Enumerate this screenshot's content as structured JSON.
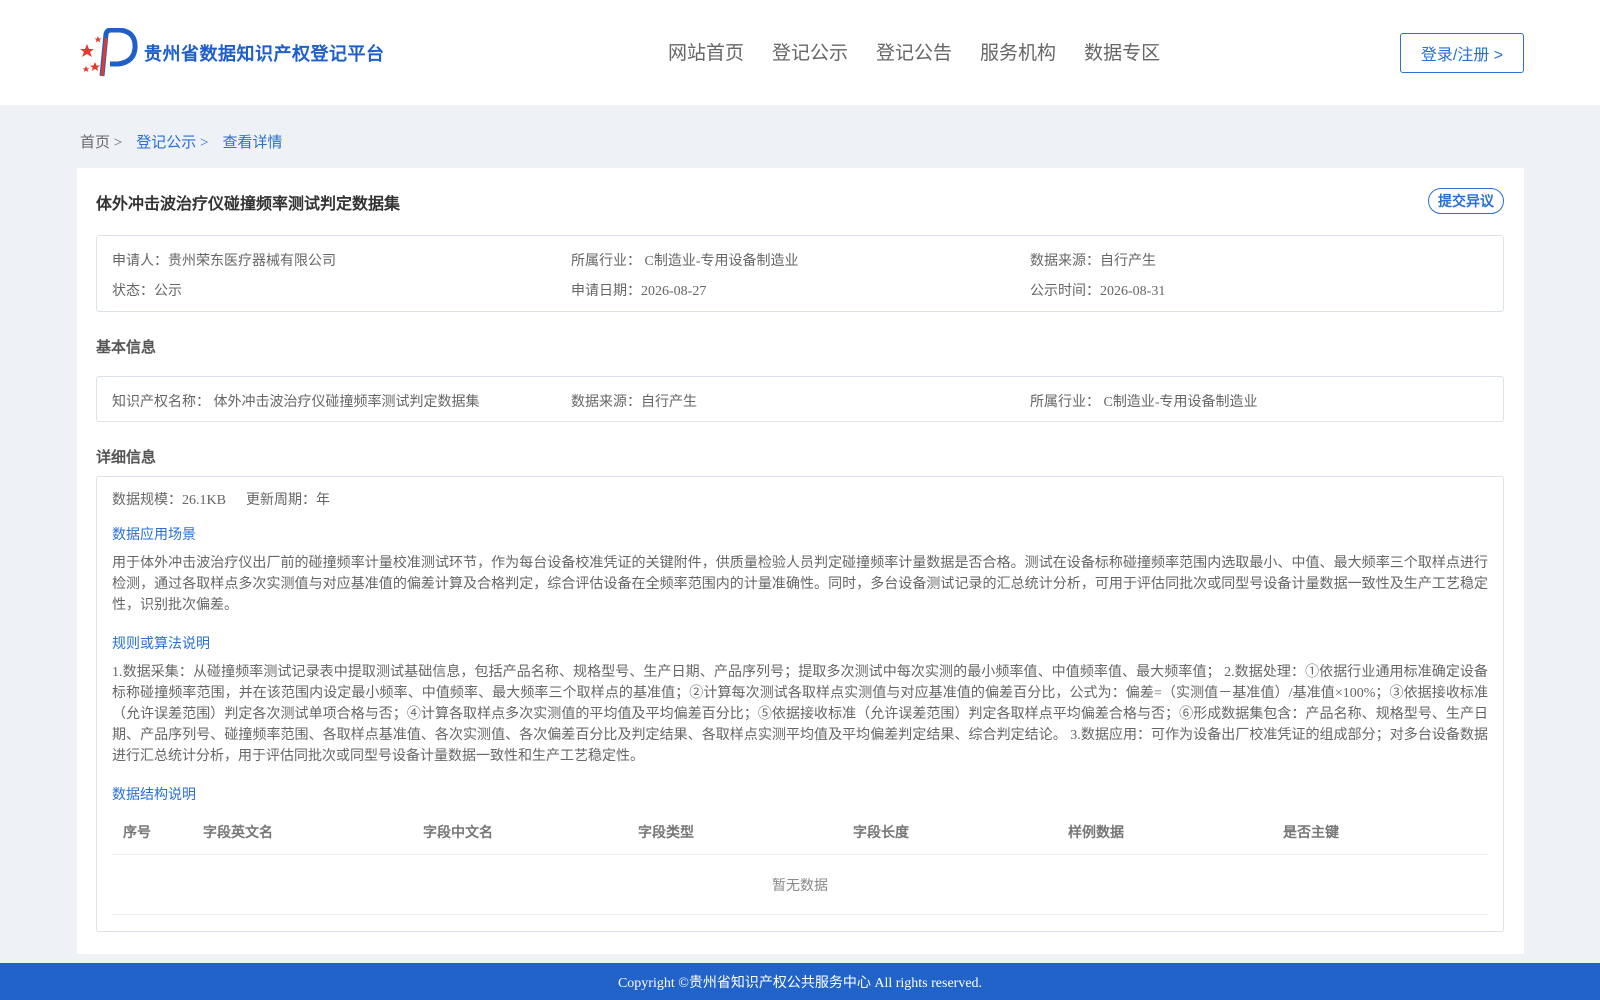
{
  "header": {
    "site_title": "贵州省数据知识产权登记平台",
    "nav": [
      "网站首页",
      "登记公示",
      "登记公告",
      "服务机构",
      "数据专区"
    ],
    "login_label": "登录/注册 >"
  },
  "breadcrumb": {
    "home": "首页 >",
    "section": "登记公示 >",
    "current": "查看详情"
  },
  "record": {
    "title": "体外冲击波治疗仪碰撞频率测试判定数据集",
    "objection_label": "提交异议",
    "applicant": "申请人：贵州荣东医疗器械有限公司",
    "industry": "所属行业： C制造业-专用设备制造业",
    "source": "数据来源：自行产生",
    "status": "状态：公示",
    "apply_date": "申请日期：2026-08-27",
    "publish_date": "公示时间：2026-08-31"
  },
  "basic": {
    "heading": "基本信息",
    "ip_name": "知识产权名称： 体外冲击波治疗仪碰撞频率测试判定数据集",
    "source": "数据来源：自行产生",
    "industry": "所属行业： C制造业-专用设备制造业"
  },
  "detail": {
    "heading": "详细信息",
    "scale": "数据规模：26.1KB",
    "cycle": "更新周期：年",
    "scenario_title": "数据应用场景",
    "scenario_text": "用于体外冲击波治疗仪出厂前的碰撞频率计量校准测试环节，作为每台设备校准凭证的关键附件，供质量检验人员判定碰撞频率计量数据是否合格。测试在设备标称碰撞频率范围内选取最小、中值、最大频率三个取样点进行检测，通过各取样点多次实测值与对应基准值的偏差计算及合格判定，综合评估设备在全频率范围内的计量准确性。同时，多台设备测试记录的汇总统计分析，可用于评估同批次或同型号设备计量数据一致性及生产工艺稳定性，识别批次偏差。",
    "algorithm_title": "规则或算法说明",
    "algorithm_text": "1.数据采集：从碰撞频率测试记录表中提取测试基础信息，包括产品名称、规格型号、生产日期、产品序列号；提取多次测试中每次实测的最小频率值、中值频率值、最大频率值； 2.数据处理：①依据行业通用标准确定设备标称碰撞频率范围，并在该范围内设定最小频率、中值频率、最大频率三个取样点的基准值；②计算每次测试各取样点实测值与对应基准值的偏差百分比，公式为：偏差=（实测值－基准值）/基准值×100%；③依据接收标准（允许误差范围）判定各次测试单项合格与否；④计算各取样点多次实测值的平均值及平均偏差百分比；⑤依据接收标准（允许误差范围）判定各取样点平均偏差合格与否；⑥形成数据集包含：产品名称、规格型号、生产日期、产品序列号、碰撞频率范围、各取样点基准值、各次实测值、各次偏差百分比及判定结果、各取样点实测平均值及平均偏差判定结果、综合判定结论。 3.数据应用：可作为设备出厂校准凭证的组成部分；对多台设备数据进行汇总统计分析，用于评估同批次或同型号设备计量数据一致性和生产工艺稳定性。",
    "structure_title": "数据结构说明",
    "columns": [
      "序号",
      "字段英文名",
      "字段中文名",
      "字段类型",
      "字段长度",
      "样例数据",
      "是否主键"
    ],
    "empty_text": "暂无数据"
  },
  "footer": {
    "copyright": "Copyright ©贵州省知识产权公共服务中心 All rights reserved."
  }
}
